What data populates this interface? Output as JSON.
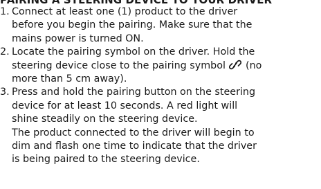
{
  "heading": "PAIRING A STEERING DEVICE TO YOUR DRIVER",
  "steps": [
    {
      "number": "1.",
      "lines": [
        "Connect at least one (1) product to the driver",
        "before you begin the pairing. Make sure that the",
        "mains power is turned ON."
      ]
    },
    {
      "number": "2.",
      "lines": [
        "Locate the pairing symbol on the driver. Hold the",
        "steering device close to the pairing symbol",
        "(no",
        "more than 5 cm away)."
      ],
      "icon": "link-icon"
    },
    {
      "number": "3.",
      "lines": [
        "Press and hold the pairing button on the steering",
        "device for at least 10 seconds. A red light will",
        "shine steadily on the steering device.",
        "The product connected to the driver will begin to",
        "dim and flash one time to indicate that the driver",
        "is being paired to the steering device."
      ]
    }
  ]
}
